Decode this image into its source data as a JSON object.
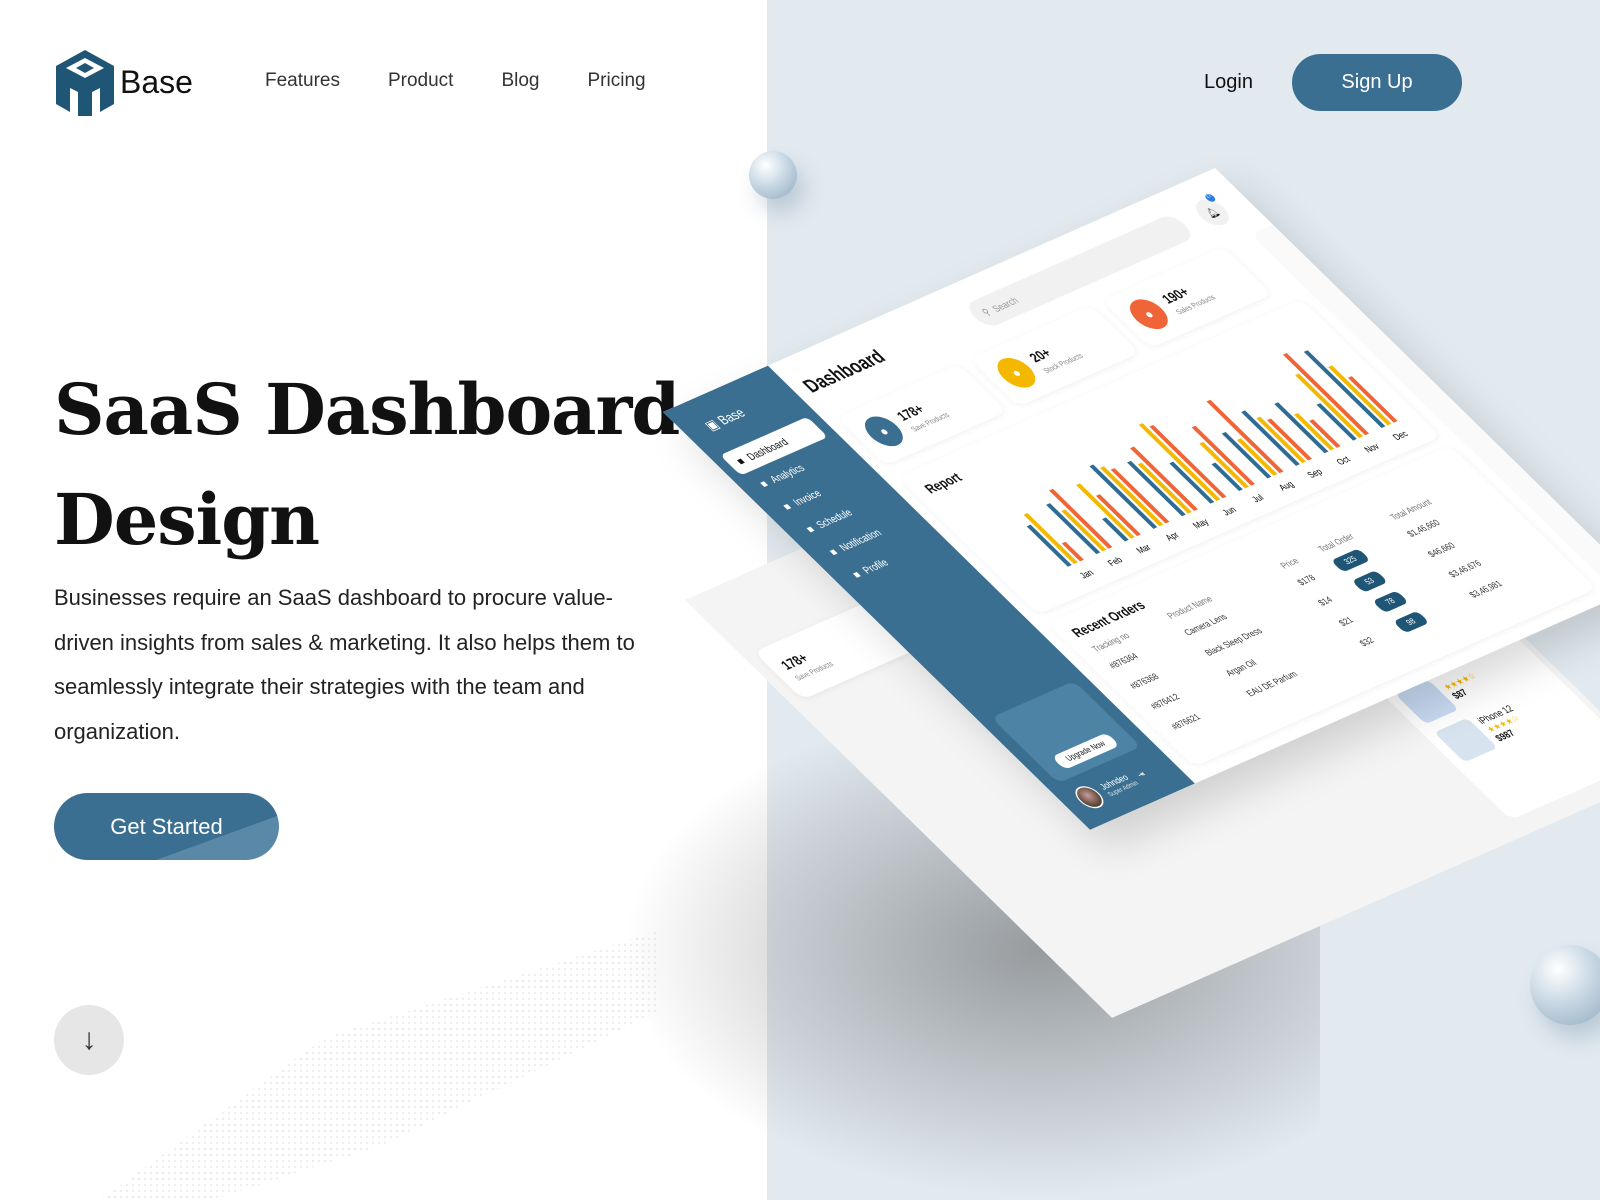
{
  "brand": {
    "name": "Base",
    "color": "#3b6f92"
  },
  "nav": {
    "items": [
      "Features",
      "Product",
      "Blog",
      "Pricing"
    ],
    "login": "Login",
    "signup": "Sign Up"
  },
  "hero": {
    "title": "SaaS Dashboard Design",
    "description": "Businesses require an SaaS dashboard to procure value-driven insights from sales & marketing. It also helps them to seamlessly integrate their strategies with the team and organization.",
    "cta": "Get Started",
    "scroll_icon": "arrow-down-icon"
  },
  "dashboard": {
    "brand": "Base",
    "title": "Dashboard",
    "search_placeholder": "Search",
    "notification_count": "17",
    "sidebar": [
      {
        "label": "Dashboard",
        "icon": "grid-icon",
        "active": true
      },
      {
        "label": "Analytics",
        "icon": "chart-icon"
      },
      {
        "label": "Invoice",
        "icon": "invoice-icon"
      },
      {
        "label": "Schedule",
        "icon": "calendar-icon"
      },
      {
        "label": "Notification",
        "icon": "bell-icon"
      },
      {
        "label": "Profile",
        "icon": "user-icon"
      }
    ],
    "upgrade": "Upgrade Now",
    "user": {
      "name": "Johndeo",
      "role": "Super Admin"
    },
    "stats": [
      {
        "value": "178+",
        "label": "Save Products",
        "color": "#3a6f91",
        "icon": "heart-icon"
      },
      {
        "value": "20+",
        "label": "Stock Products",
        "color": "#f5b800",
        "icon": "box-icon"
      },
      {
        "value": "190+",
        "label": "Sales Products",
        "color": "#f06537",
        "icon": "bag-icon"
      }
    ],
    "report_title": "Report",
    "orders": {
      "title": "Recent Orders",
      "columns": [
        "Tracking no",
        "Product Name",
        "Price",
        "Total Order",
        "Total Amount"
      ],
      "rows": [
        [
          "#876364",
          "Camera Lens",
          "$178",
          "325",
          "$1,46,660"
        ],
        [
          "#876368",
          "Black Sleep Dress",
          "$14",
          "53",
          "$46,660"
        ],
        [
          "#876412",
          "Argan Oil",
          "$21",
          "78",
          "$3,46,676"
        ],
        [
          "#876621",
          "EAU DE Parfum",
          "$32",
          "98",
          "$3,46,981"
        ]
      ]
    },
    "products": [
      {
        "name": "",
        "price": "$87",
        "rating": 4
      },
      {
        "name": "iPhone 12",
        "price": "$987",
        "rating": 4
      }
    ]
  },
  "chart_data": {
    "type": "bar",
    "categories": [
      "Jan",
      "Feb",
      "Mar",
      "Apr",
      "May",
      "Jun",
      "Jul",
      "Aug",
      "Sep",
      "Oct",
      "Nov",
      "Dec"
    ],
    "series": [
      {
        "color": "#2f6c93",
        "values": [
          45,
          55,
          25,
          70,
          60,
          45,
          30,
          50,
          60,
          55,
          40,
          85
        ]
      },
      {
        "color": "#f5b800",
        "values": [
          55,
          45,
          60,
          65,
          55,
          85,
          50,
          40,
          50,
          40,
          70,
          65
        ]
      },
      {
        "color": "#f06537",
        "values": [
          20,
          65,
          45,
          60,
          70,
          80,
          65,
          80,
          45,
          30,
          90,
          50
        ]
      }
    ]
  }
}
